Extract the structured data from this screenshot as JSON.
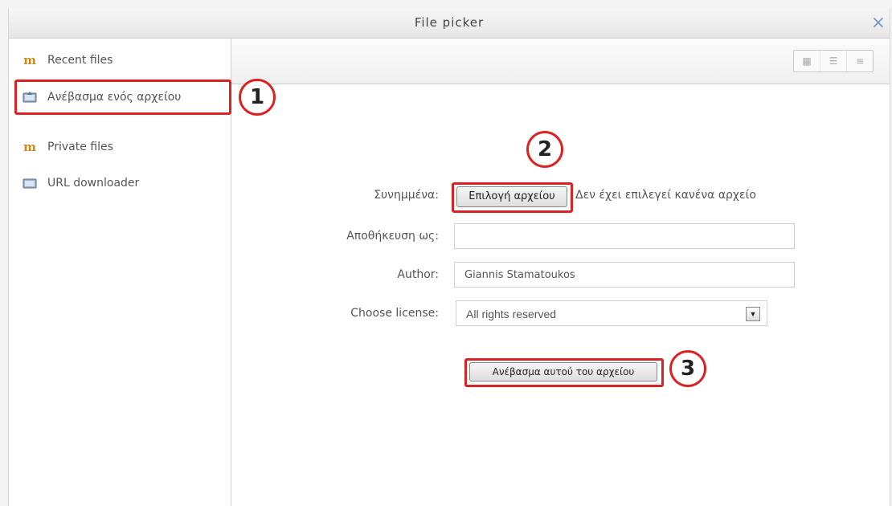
{
  "dialog": {
    "title": "File picker",
    "close_label": "×"
  },
  "sidebar": {
    "items": [
      {
        "label": "Recent files",
        "icon": "moodle-icon"
      },
      {
        "label": "Ανέβασμα ενός αρχείου",
        "icon": "upload-icon"
      },
      {
        "label": "Private files",
        "icon": "moodle-icon"
      },
      {
        "label": "URL downloader",
        "icon": "download-icon"
      }
    ]
  },
  "toolbar": {
    "view_icons": [
      "icons-view-icon",
      "list-view-icon",
      "tree-view-icon"
    ]
  },
  "callouts": [
    "1",
    "2",
    "3"
  ],
  "form": {
    "attachment_label": "Συνημμένα:",
    "choose_file_button": "Επιλογή αρχείου",
    "no_file_text": "Δεν έχει επιλεγεί κανένα αρχείο",
    "save_as_label": "Αποθήκευση ως:",
    "save_as_value": "",
    "author_label": "Author:",
    "author_value": "Giannis Stamatoukos",
    "license_label": "Choose license:",
    "license_value": "All rights reserved",
    "upload_button": "Ανέβασμα αυτού του αρχείου"
  },
  "colors": {
    "highlight": "#dd2222",
    "accent": "#7a9cc6"
  }
}
